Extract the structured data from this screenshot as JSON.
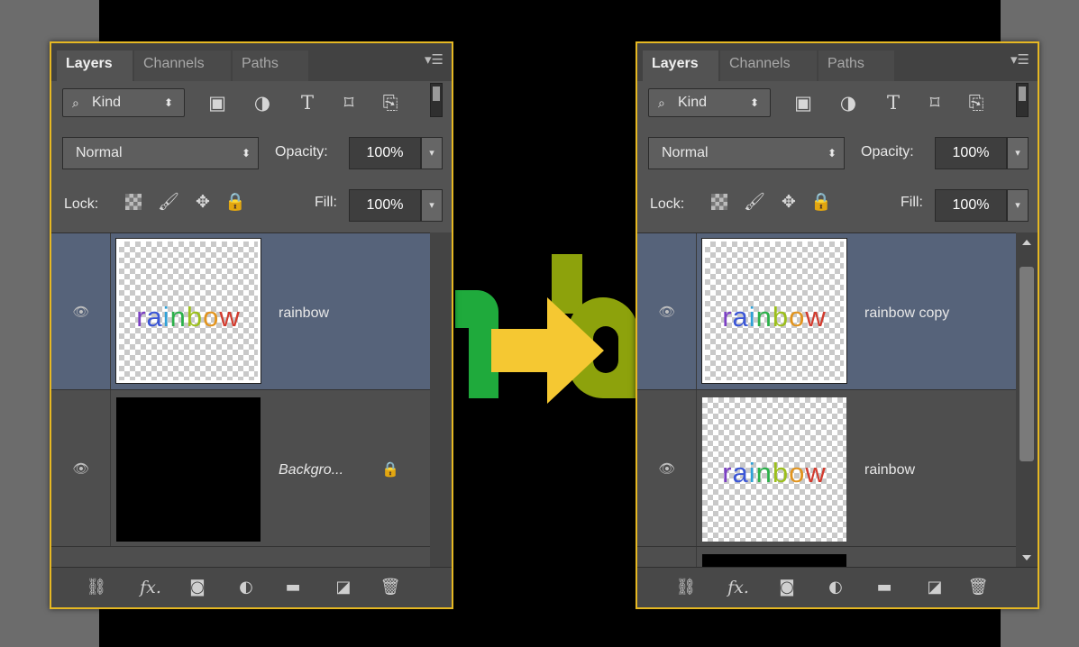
{
  "colors": {
    "panel_border": "#e6b823",
    "selected_layer": "#56637a",
    "arrow": "#f5c832",
    "deco_green": "#1faa3c",
    "deco_olive": "#8da20c"
  },
  "left_panel": {
    "tabs": [
      "Layers",
      "Channels",
      "Paths"
    ],
    "filter": {
      "label": "Kind",
      "icons": [
        "image-filter-icon",
        "adjustment-filter-icon",
        "type-filter-icon",
        "shape-filter-icon",
        "smart-object-filter-icon"
      ]
    },
    "blend_mode": "Normal",
    "opacity_label": "Opacity:",
    "opacity": "100%",
    "lock_label": "Lock:",
    "fill_label": "Fill:",
    "fill": "100%",
    "layers": [
      {
        "name": "rainbow",
        "thumb_text": "rainbow",
        "selected": true
      },
      {
        "name": "Backgro...",
        "thumb_text": "",
        "locked": true
      }
    ]
  },
  "right_panel": {
    "tabs": [
      "Layers",
      "Channels",
      "Paths"
    ],
    "filter": {
      "label": "Kind"
    },
    "blend_mode": "Normal",
    "opacity_label": "Opacity:",
    "opacity": "100%",
    "lock_label": "Lock:",
    "fill_label": "Fill:",
    "fill": "100%",
    "layers": [
      {
        "name": "rainbow copy",
        "thumb_text": "rainbow",
        "selected": true
      },
      {
        "name": "rainbow",
        "thumb_text": "rainbow"
      }
    ]
  },
  "thumb_letters": [
    "r",
    "a",
    "i",
    "n",
    "b",
    "o",
    "w"
  ],
  "thumb_letter_colors": [
    "#7b3fc4",
    "#3b56d6",
    "#2ea1d8",
    "#2bb14a",
    "#9cbf1c",
    "#e2941d",
    "#d23b2e"
  ]
}
